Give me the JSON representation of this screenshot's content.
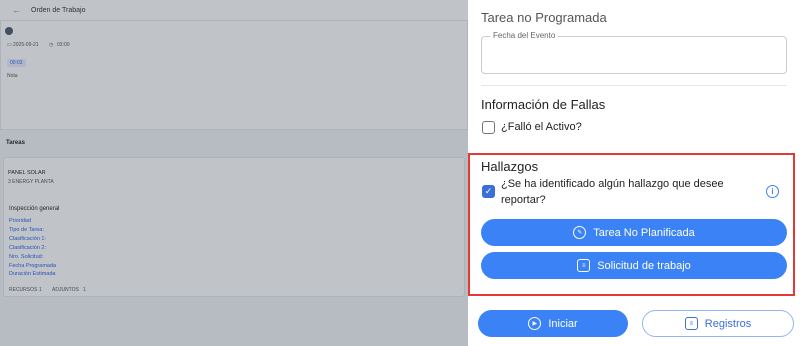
{
  "background": {
    "header_title": "Orden de Trabajo",
    "date": "2025-09-21",
    "time": "03:00",
    "duration_badge": "00:03",
    "note_label": "Nota",
    "tasks_title": "Tareas",
    "task_name": "PANEL SOLAR",
    "task_sub": "3 ENERGY PLANTA",
    "inspection_title": "Inspección general",
    "fields": [
      "Prioridad",
      "Tipo de Tarea:",
      "Clasificación 1:",
      "Clasificación 2:",
      "Nro. Solicitud:",
      "Fecha Programada",
      "Duración Estimada"
    ],
    "recursos_label": "RECURSOS",
    "recursos_count": "1",
    "adjuntos_label": "ADJUNTOS",
    "adjuntos_count": "1"
  },
  "panel": {
    "title": "Tarea no Programada",
    "event_date_label": "Fecha del Evento",
    "event_date_value": "",
    "failure_section": "Información de Fallas",
    "failure_question": "¿Falló el Activo?",
    "failure_checked": false,
    "findings_section": "Hallazgos",
    "findings_question": "¿Se ha identificado algún hallazgo que desee reportar?",
    "findings_checked": true,
    "btn_unplanned": "Tarea No Planificada",
    "btn_request": "Solicitud de trabajo",
    "btn_start": "Iniciar",
    "btn_records": "Registros"
  },
  "colors": {
    "accent": "#3b82f6",
    "highlight_border": "#e53935"
  }
}
